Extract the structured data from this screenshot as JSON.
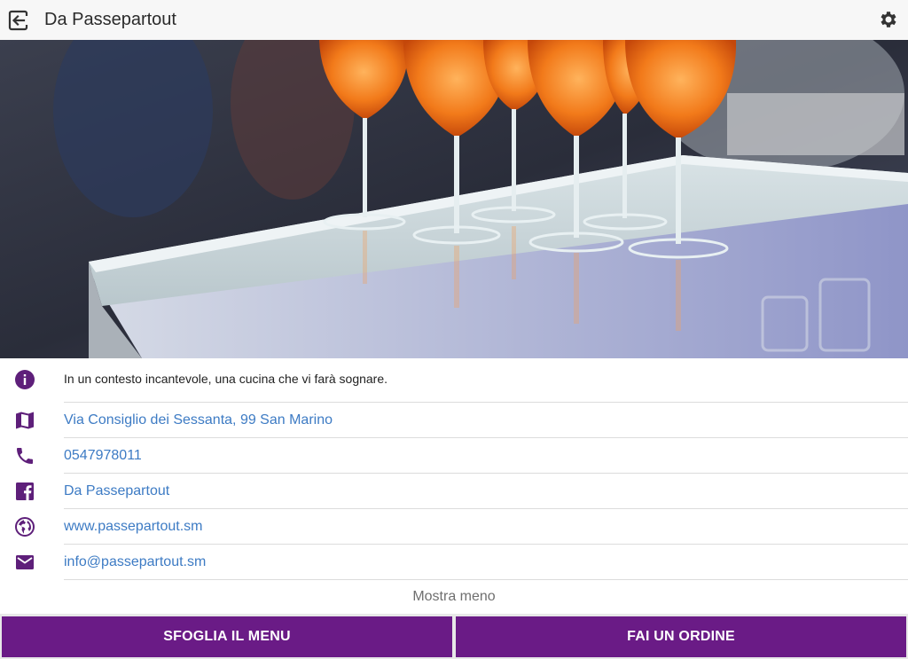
{
  "header": {
    "title": "Da Passepartout",
    "back_icon": "exit-arrow-icon",
    "settings_icon": "gear-icon"
  },
  "hero": {
    "image_subject": "glasses of orange spritz on a glass bar counter"
  },
  "info": {
    "description": "In un contesto incantevole, una cucina che vi farà sognare.",
    "address": "Via Consiglio dei Sessanta, 99 San Marino",
    "phone": "0547978011",
    "facebook": "Da Passepartout",
    "website": "www.passepartout.sm",
    "email": "info@passepartout.sm",
    "icons": [
      "info-icon",
      "map-icon",
      "phone-icon",
      "facebook-icon",
      "globe-icon",
      "mail-icon"
    ]
  },
  "toggle_label": "Mostra meno",
  "actions": {
    "browse_menu": "SFOGLIA IL MENU",
    "order": "FAI UN ORDINE"
  },
  "colors": {
    "accent": "#6a1b86",
    "link": "#3d7bc4",
    "icon": "#5e1f7a"
  }
}
